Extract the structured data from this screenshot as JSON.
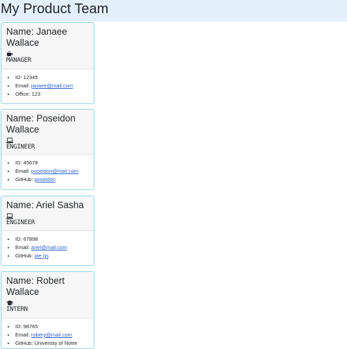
{
  "page": {
    "title": "My Product Team"
  },
  "accent_color": "#8fd3e6",
  "header_bg": "#e3f0fb",
  "team": [
    {
      "name": "Name: Janaee Wallace",
      "role": "Manager",
      "role_icon": "coffee-cup-icon",
      "id_line_label": "ID: ",
      "id": "12345",
      "email_label": "Email: ",
      "email": "janaee@mail.com",
      "extra_label": "Office: ",
      "extra": "123"
    },
    {
      "name": "Name: Poseidon Wallace",
      "role": "Engineer",
      "role_icon": "laptop-icon",
      "id_line_label": "ID: ",
      "id": "45678",
      "email_label": "Email: ",
      "email": "poseidon@mail.com",
      "extra_label": "GitHub: ",
      "extra": "poseidon"
    },
    {
      "name": "Name: Ariel Sasha",
      "role": "Engineer",
      "role_icon": "laptop-icon",
      "id_line_label": "ID: ",
      "id": "67898",
      "email_label": "Email: ",
      "email": "ariel@mail.com",
      "extra_label": "GitHub: ",
      "extra": "jae-gs"
    },
    {
      "name": "Name: Robert Wallace",
      "role": "Intern",
      "role_icon": "graduation-cap-icon",
      "id_line_label": "ID: ",
      "id": "98765",
      "email_label": "Email: ",
      "email": "robery@mail.com",
      "extra_label": "GitHub: ",
      "extra": "Univeristy of Notre"
    }
  ]
}
